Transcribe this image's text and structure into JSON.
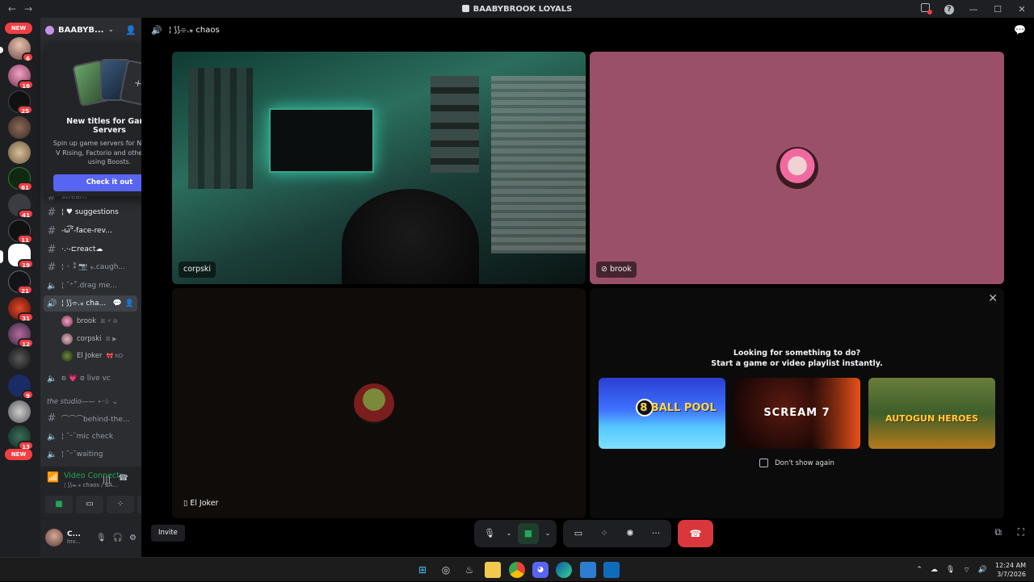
{
  "window": {
    "nav_back": "←",
    "nav_forward": "→",
    "title": "BAABYBROOK LOYALS",
    "minimize": "—",
    "maximize": "☐",
    "close": "✕"
  },
  "rail": {
    "new_label_top": "NEW",
    "new_label_bottom": "NEW",
    "badges": [
      "6",
      "16",
      "25",
      "61",
      "41",
      "11",
      "19",
      "21",
      "31",
      "12",
      "9",
      "13"
    ]
  },
  "sidebar": {
    "server_name": "BAABYB...",
    "categories": {
      "studio": "the studio—— ⋆·☆ ⌄"
    },
    "channels": [
      {
        "kind": "text",
        "label": "stream"
      },
      {
        "kind": "text",
        "label": "¦ ♥︎ suggestions"
      },
      {
        "kind": "text",
        "label": "-ω͡͡\"-face-rev..."
      },
      {
        "kind": "text",
        "label": "·.·-⊏react☁︎"
      },
      {
        "kind": "text",
        "label": "¦ ◦ ⁑ 📷 ⁎.caugh..."
      },
      {
        "kind": "voice",
        "label": "¦ ˘⁺˚.drag me..."
      },
      {
        "kind": "voice",
        "label": "¦ ⟆⟆⌯.⁎ cha..."
      },
      {
        "kind": "voice",
        "label": "ʚ 💗 ɞ live vc"
      },
      {
        "kind": "text",
        "label": "⌒⌒⌒behind-the..."
      },
      {
        "kind": "voice",
        "label": "¦ ˘ᵕ˘mic check"
      },
      {
        "kind": "voice",
        "label": "¦ ˘ᵕ˘waiting"
      }
    ],
    "members": [
      {
        "name": "brook",
        "extra": "ꕥ ⚡ ⊘"
      },
      {
        "name": "corpski",
        "extra": "ꕥ ▶"
      },
      {
        "name": "El Joker",
        "extra": "🎀 KO"
      }
    ]
  },
  "popup": {
    "close": "✕",
    "title": "New titles for Game Servers",
    "body": "Spin up game servers for Necesse, V Rising, Factorio and other titles using Boosts.",
    "cta": "Check it out"
  },
  "voice_panel": {
    "status": "Video Connected",
    "location": "¦ ⟆⟆⌯.⁎ chaos / BA...",
    "user_name": "C...",
    "user_status": "Inv..."
  },
  "stage": {
    "channel_name": "¦ ⟆⟆⌯.⁎ chaos",
    "tiles": [
      {
        "name": "corpski"
      },
      {
        "name": "brook"
      },
      {
        "name": "El Joker"
      }
    ],
    "activity": {
      "heading_line1": "Looking for something to do?",
      "heading_line2": "Start a game or video playlist instantly.",
      "games": [
        {
          "title": "8 BALL POOL"
        },
        {
          "title": "SCREAM 7"
        },
        {
          "title": "AUTOGUN HEROES"
        }
      ],
      "dont_show": "Don't show again",
      "close": "✕"
    },
    "invite_label": "Invite"
  },
  "taskbar": {
    "time": "12:24 AM",
    "date": "3/7/2026"
  },
  "colors": {
    "accent": "#5865f2",
    "success": "#23a55a",
    "danger": "#da373c",
    "brook_bg": "#9a5068"
  }
}
